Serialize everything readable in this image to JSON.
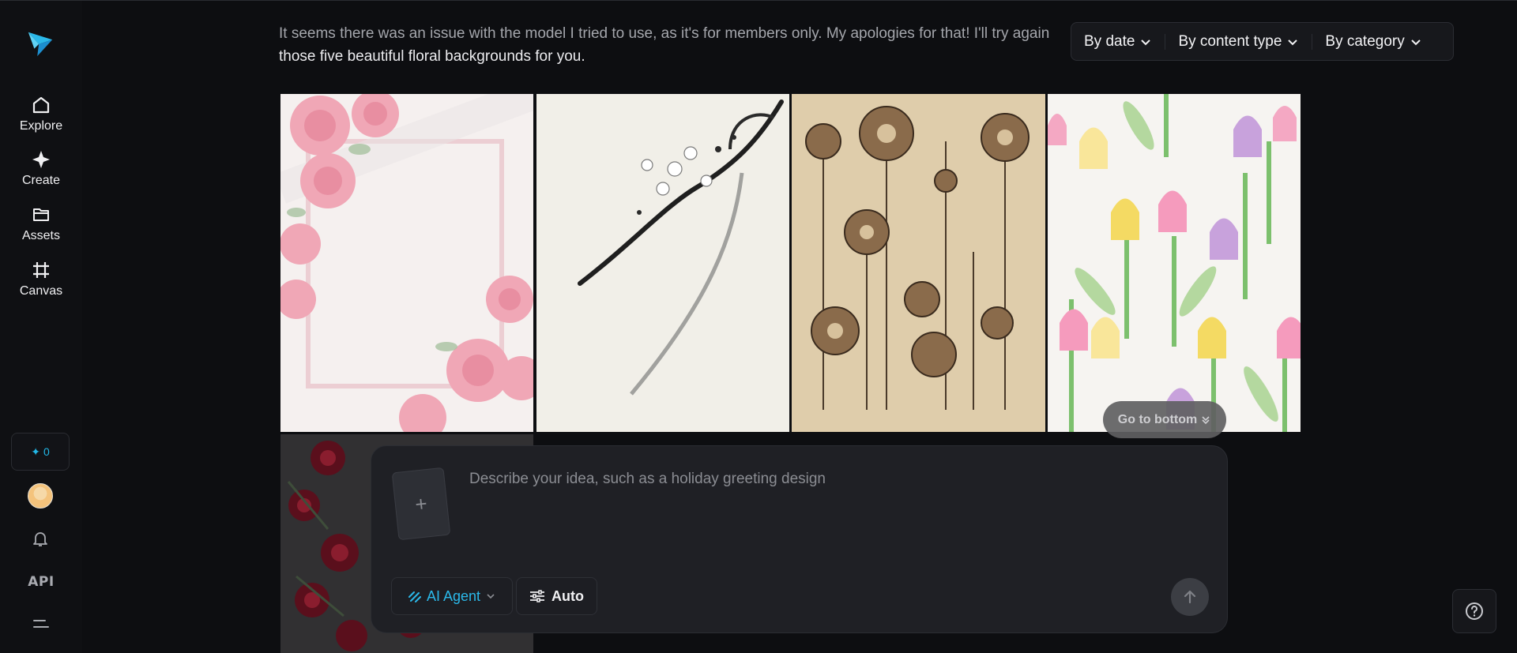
{
  "sidebar": {
    "logo": "app-logo",
    "items": [
      {
        "label": "Explore",
        "icon": "home-icon"
      },
      {
        "label": "Create",
        "icon": "sparkle-icon"
      },
      {
        "label": "Assets",
        "icon": "folder-icon"
      },
      {
        "label": "Canvas",
        "icon": "crop-icon"
      }
    ],
    "credits": "0",
    "api_label": "API"
  },
  "message": {
    "line1": "It seems there was an issue with the model I tried to use, as it's for members only. My apologies for that! I'll try again",
    "line2": "those five beautiful floral backgrounds for you."
  },
  "filters": {
    "by_date": "By date",
    "by_content_type": "By content type",
    "by_category": "By category"
  },
  "images": [
    {
      "subject": "pink watercolor roses frame"
    },
    {
      "subject": "ink wash blossom branch"
    },
    {
      "subject": "vintage botanical flowers"
    },
    {
      "subject": "pastel tulips pattern"
    },
    {
      "subject": "dark red roses"
    }
  ],
  "go_to_bottom": "Go to bottom",
  "composer": {
    "placeholder": "Describe your idea, such as a holiday greeting design",
    "agent_label": "AI Agent",
    "auto_label": "Auto"
  },
  "colors": {
    "accent": "#22b8e8",
    "background": "#0d0e11",
    "panel": "#1f2025"
  }
}
